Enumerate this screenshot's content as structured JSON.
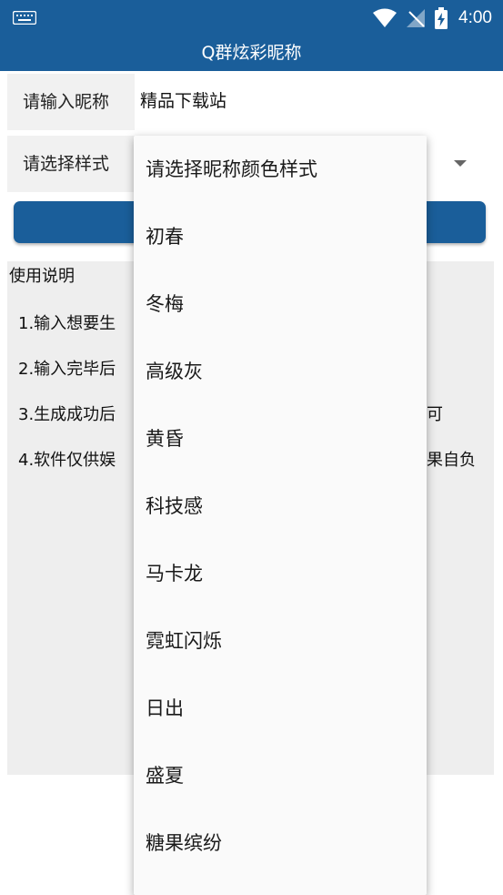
{
  "status_bar": {
    "time": "4:00",
    "icons": [
      "keyboard-icon",
      "wifi-icon",
      "no-signal-icon",
      "battery-charging-icon"
    ],
    "background": "#1a5e9a"
  },
  "app": {
    "title": "Q群炫彩昵称"
  },
  "form": {
    "nickname_label": "请输入昵称",
    "nickname_value": "精品下载站",
    "style_label": "请选择样式",
    "generate_button_color": "#1a5e9a"
  },
  "instructions": {
    "title": "使用说明",
    "lines": [
      "1.输入想要生",
      "2.输入完毕后",
      "3.生成成功后",
      "4.软件仅供娱"
    ],
    "tails": [
      "可",
      "果自负"
    ]
  },
  "dropdown": {
    "options": [
      "请选择昵称颜色样式",
      "初春",
      "冬梅",
      "高级灰",
      "黄昏",
      "科技感",
      "马卡龙",
      "霓虹闪烁",
      "日出",
      "盛夏",
      "糖果缤纷"
    ]
  }
}
